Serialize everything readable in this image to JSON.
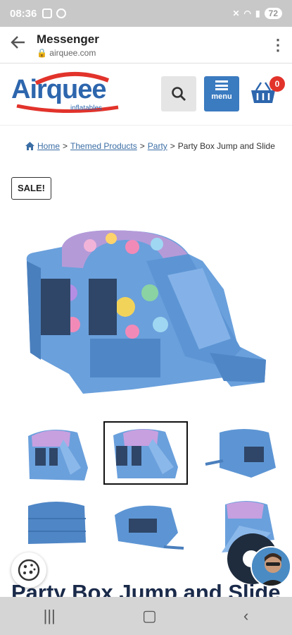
{
  "status": {
    "time": "08:36",
    "battery": "72"
  },
  "appbar": {
    "title": "Messenger",
    "url": "airquee.com"
  },
  "header": {
    "logo_text": "Airquee",
    "logo_sub": "inflatables",
    "menu_label": "menu",
    "cart_count": "0"
  },
  "breadcrumb": {
    "items": [
      "Home",
      "Themed Products",
      "Party"
    ],
    "separator": ">",
    "current": "Party Box Jump and Slide"
  },
  "badge": "SALE!",
  "product_title": "Party Box Jump and Slide",
  "colors": {
    "brand_blue": "#2d66ad",
    "accent_red": "#e2332b",
    "menu_blue": "#3b7bc0"
  },
  "icons": [
    "back-arrow-icon",
    "kebab-icon",
    "search-icon",
    "hamburger-icon",
    "basket-icon",
    "home-icon",
    "cookie-icon",
    "chat-icon"
  ]
}
